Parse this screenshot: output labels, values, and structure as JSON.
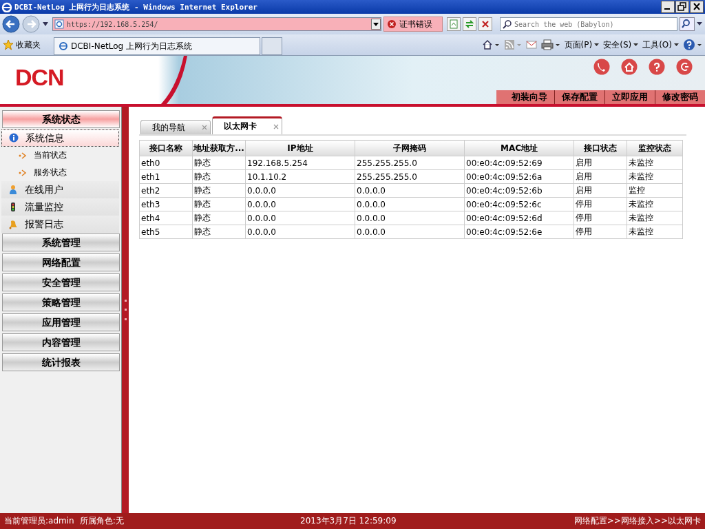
{
  "window": {
    "title": "DCBI-NetLog 上网行为日志系统 - Windows Internet Explorer"
  },
  "browser": {
    "address": "https://192.168.5.254/",
    "cert_error": "证书错误",
    "search": {
      "placeholder": "Search the web (Babylon)"
    },
    "favorites": "收藏夹",
    "tab_title": "DCBI-NetLog 上网行为日志系统",
    "commands": [
      "页面(P)",
      "安全(S)",
      "工具(O)"
    ]
  },
  "header": {
    "logo": "DCN",
    "actions": [
      "初装向导",
      "保存配置",
      "立即应用",
      "修改密码"
    ]
  },
  "sidebar": {
    "groups": [
      {
        "label": "系统状态",
        "expanded": true,
        "items": [
          {
            "label": "系统信息",
            "selected": true,
            "children": [
              {
                "label": "当前状态"
              },
              {
                "label": "服务状态"
              }
            ]
          },
          {
            "label": "在线用户",
            "selected": false
          },
          {
            "label": "流量监控",
            "selected": false
          },
          {
            "label": "报警日志",
            "selected": false
          }
        ]
      },
      {
        "label": "系统管理",
        "expanded": false
      },
      {
        "label": "网络配置",
        "expanded": false
      },
      {
        "label": "安全管理",
        "expanded": false
      },
      {
        "label": "策略管理",
        "expanded": false
      },
      {
        "label": "应用管理",
        "expanded": false
      },
      {
        "label": "内容管理",
        "expanded": false
      },
      {
        "label": "统计报表",
        "expanded": false
      }
    ]
  },
  "tabs": [
    {
      "label": "我的导航",
      "selected": false
    },
    {
      "label": "以太网卡",
      "selected": true
    }
  ],
  "table": {
    "columns": [
      "接口名称",
      "地址获取方...",
      "IP地址",
      "子网掩码",
      "MAC地址",
      "接口状态",
      "监控状态"
    ],
    "rows": [
      [
        "eth0",
        "静态",
        "192.168.5.254",
        "255.255.255.0",
        "00:e0:4c:09:52:69",
        "启用",
        "未监控"
      ],
      [
        "eth1",
        "静态",
        "10.1.10.2",
        "255.255.255.0",
        "00:e0:4c:09:52:6a",
        "启用",
        "未监控"
      ],
      [
        "eth2",
        "静态",
        "0.0.0.0",
        "0.0.0.0",
        "00:e0:4c:09:52:6b",
        "启用",
        "监控"
      ],
      [
        "eth3",
        "静态",
        "0.0.0.0",
        "0.0.0.0",
        "00:e0:4c:09:52:6c",
        "停用",
        "未监控"
      ],
      [
        "eth4",
        "静态",
        "0.0.0.0",
        "0.0.0.0",
        "00:e0:4c:09:52:6d",
        "停用",
        "未监控"
      ],
      [
        "eth5",
        "静态",
        "0.0.0.0",
        "0.0.0.0",
        "00:e0:4c:09:52:6e",
        "停用",
        "未监控"
      ]
    ]
  },
  "status_bar": {
    "user": "当前管理员:admin",
    "role": "所属角色:无",
    "datetime": "2013年3月7日 12:59:09",
    "breadcrumb": "网络配置>>网络接入>>以太网卡"
  }
}
